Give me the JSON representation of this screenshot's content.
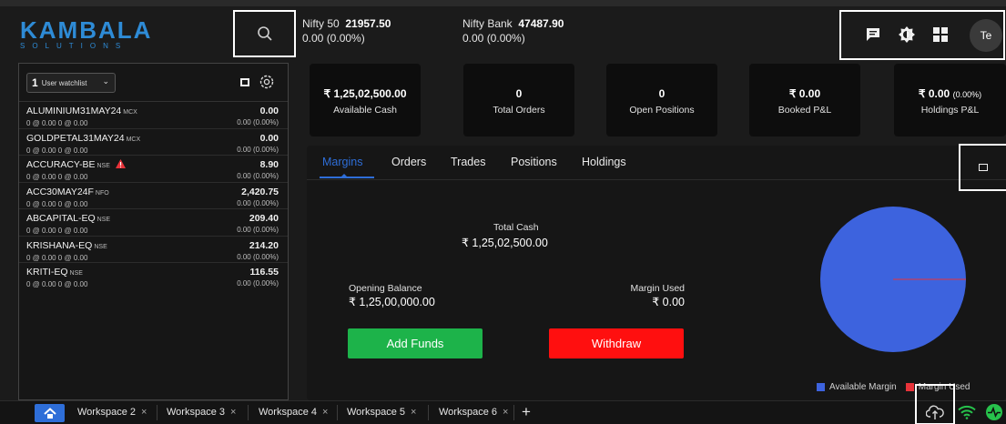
{
  "brand": {
    "logo_main": "KAMBALA",
    "logo_sub": "SOLUTIONS",
    "color": "#2e8bd6"
  },
  "header": {
    "tickers": [
      {
        "name": "Nifty 50",
        "value": "21957.50",
        "change": "0.00 (0.00%)"
      },
      {
        "name": "Nifty Bank",
        "value": "47487.90",
        "change": "0.00 (0.00%)"
      }
    ],
    "icons": [
      "search-icon",
      "message-icon",
      "theme-icon",
      "grid-icon"
    ],
    "avatar": "Te"
  },
  "watchlist": {
    "count": "1",
    "name": "User watchlist",
    "rows": [
      {
        "symbol": "ALUMINIUM31MAY24",
        "exchange": "MCX",
        "sub": "0 @ 0.00   0 @ 0.00",
        "ltp": "0.00",
        "change": "0.00 (0.00%)",
        "warn": false
      },
      {
        "symbol": "GOLDPETAL31MAY24",
        "exchange": "MCX",
        "sub": "0 @ 0.00   0 @ 0.00",
        "ltp": "0.00",
        "change": "0.00 (0.00%)",
        "warn": false
      },
      {
        "symbol": "ACCURACY-BE",
        "exchange": "NSE",
        "sub": "0 @ 0.00   0 @ 0.00",
        "ltp": "8.90",
        "change": "0.00 (0.00%)",
        "warn": true
      },
      {
        "symbol": "ACC30MAY24F",
        "exchange": "NFO",
        "sub": "0 @ 0.00   0 @ 0.00",
        "ltp": "2,420.75",
        "change": "0.00 (0.00%)",
        "warn": false
      },
      {
        "symbol": "ABCAPITAL-EQ",
        "exchange": "NSE",
        "sub": "0 @ 0.00   0 @ 0.00",
        "ltp": "209.40",
        "change": "0.00 (0.00%)",
        "warn": false
      },
      {
        "symbol": "KRISHANA-EQ",
        "exchange": "NSE",
        "sub": "0 @ 0.00   0 @ 0.00",
        "ltp": "214.20",
        "change": "0.00 (0.00%)",
        "warn": false
      },
      {
        "symbol": "KRITI-EQ",
        "exchange": "NSE",
        "sub": "0 @ 0.00   0 @ 0.00",
        "ltp": "116.55",
        "change": "0.00 (0.00%)",
        "warn": false
      }
    ]
  },
  "cards": [
    {
      "value": "₹ 1,25,02,500.00",
      "label": "Available Cash"
    },
    {
      "value": "0",
      "label": "Total Orders"
    },
    {
      "value": "0",
      "label": "Open Positions"
    },
    {
      "value": "₹ 0.00",
      "label": "Booked P&L"
    },
    {
      "value": "₹ 0.00",
      "value_suffix": "(0.00%)",
      "label": "Holdings P&L"
    }
  ],
  "panel": {
    "tabs": [
      "Margins",
      "Orders",
      "Trades",
      "Positions",
      "Holdings"
    ],
    "active_tab": "Margins",
    "total_cash_label": "Total Cash",
    "total_cash_value": "₹ 1,25,02,500.00",
    "opening_balance_label": "Opening Balance",
    "opening_balance_value": "₹ 1,25,00,000.00",
    "margin_used_label": "Margin Used",
    "margin_used_value": "₹ 0.00",
    "add_funds_label": "Add Funds",
    "withdraw_label": "Withdraw"
  },
  "chart_data": {
    "type": "pie",
    "labels": [
      "Available Margin",
      "Margin Used"
    ],
    "values": [
      12502500,
      0
    ],
    "colors": [
      "#3d63de",
      "#e8333a"
    ],
    "legend": "bottom-right"
  },
  "footer": {
    "workspaces": [
      "Workspace 2",
      "Workspace 3",
      "Workspace 4",
      "Workspace 5",
      "Workspace 6"
    ],
    "add_label": "+",
    "close_glyph": "×"
  },
  "colors": {
    "accent": "#2e6ed8",
    "success": "#1db34a",
    "danger": "#ff0f0f"
  }
}
